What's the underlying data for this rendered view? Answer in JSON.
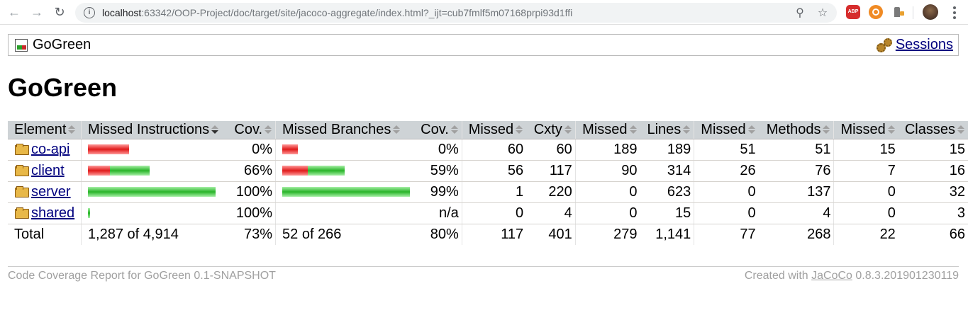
{
  "browser": {
    "url_host": "localhost",
    "url_rest": ":63342/OOP-Project/doc/target/site/jacoco-aggregate/index.html?_ijt=cub7fmlf5m07168prpi93d1ffi",
    "extensions": [
      "adblock-plus-icon",
      "ublock-icon",
      "extension-icon"
    ],
    "abp_label": "ABP"
  },
  "breadcrumb": {
    "title": "GoGreen",
    "sessions_label": "Sessions"
  },
  "page": {
    "heading": "GoGreen"
  },
  "table": {
    "headers": [
      "Element",
      "Missed Instructions",
      "Cov.",
      "Missed Branches",
      "Cov.",
      "Missed",
      "Cxty",
      "Missed",
      "Lines",
      "Missed",
      "Methods",
      "Missed",
      "Classes"
    ],
    "rows": [
      {
        "name": "co-api",
        "instr_missed_frac": 0.32,
        "instr_covered_frac": 0.0,
        "instr_cov": "0%",
        "branch_missed_frac": 0.12,
        "branch_covered_frac": 0.0,
        "branch_cov": "0%",
        "cxty_missed": "60",
        "cxty": "60",
        "lines_missed": "189",
        "lines": "189",
        "methods_missed": "51",
        "methods": "51",
        "classes_missed": "15",
        "classes": "15"
      },
      {
        "name": "client",
        "instr_missed_frac": 0.17,
        "instr_covered_frac": 0.31,
        "instr_cov": "66%",
        "branch_missed_frac": 0.2,
        "branch_covered_frac": 0.29,
        "branch_cov": "59%",
        "cxty_missed": "56",
        "cxty": "117",
        "lines_missed": "90",
        "lines": "314",
        "methods_missed": "26",
        "methods": "76",
        "classes_missed": "7",
        "classes": "16"
      },
      {
        "name": "server",
        "instr_missed_frac": 0.0,
        "instr_covered_frac": 1.0,
        "instr_cov": "100%",
        "branch_missed_frac": 0.0,
        "branch_covered_frac": 1.0,
        "branch_cov": "99%",
        "cxty_missed": "1",
        "cxty": "220",
        "lines_missed": "0",
        "lines": "623",
        "methods_missed": "0",
        "methods": "137",
        "classes_missed": "0",
        "classes": "32"
      },
      {
        "name": "shared",
        "instr_missed_frac": 0.0,
        "instr_covered_frac": 0.015,
        "instr_cov": "100%",
        "branch_missed_frac": 0.0,
        "branch_covered_frac": 0.0,
        "branch_cov": "n/a",
        "cxty_missed": "0",
        "cxty": "4",
        "lines_missed": "0",
        "lines": "15",
        "methods_missed": "0",
        "methods": "4",
        "classes_missed": "0",
        "classes": "3"
      }
    ],
    "total": {
      "label": "Total",
      "instr": "1,287 of 4,914",
      "instr_cov": "73%",
      "branch": "52 of 266",
      "branch_cov": "80%",
      "cxty_missed": "117",
      "cxty": "401",
      "lines_missed": "279",
      "lines": "1,141",
      "methods_missed": "77",
      "methods": "268",
      "classes_missed": "22",
      "classes": "66"
    }
  },
  "footer": {
    "left": "Code Coverage Report for GoGreen 0.1-SNAPSHOT",
    "right_prefix": "Created with ",
    "right_link": "JaCoCo",
    "right_suffix": " 0.8.3.201901230119"
  },
  "colors": {
    "missed_bar": "#e01a1a",
    "covered_bar": "#28b428",
    "header_bg": "#ced3d6",
    "link": "#00007f"
  }
}
